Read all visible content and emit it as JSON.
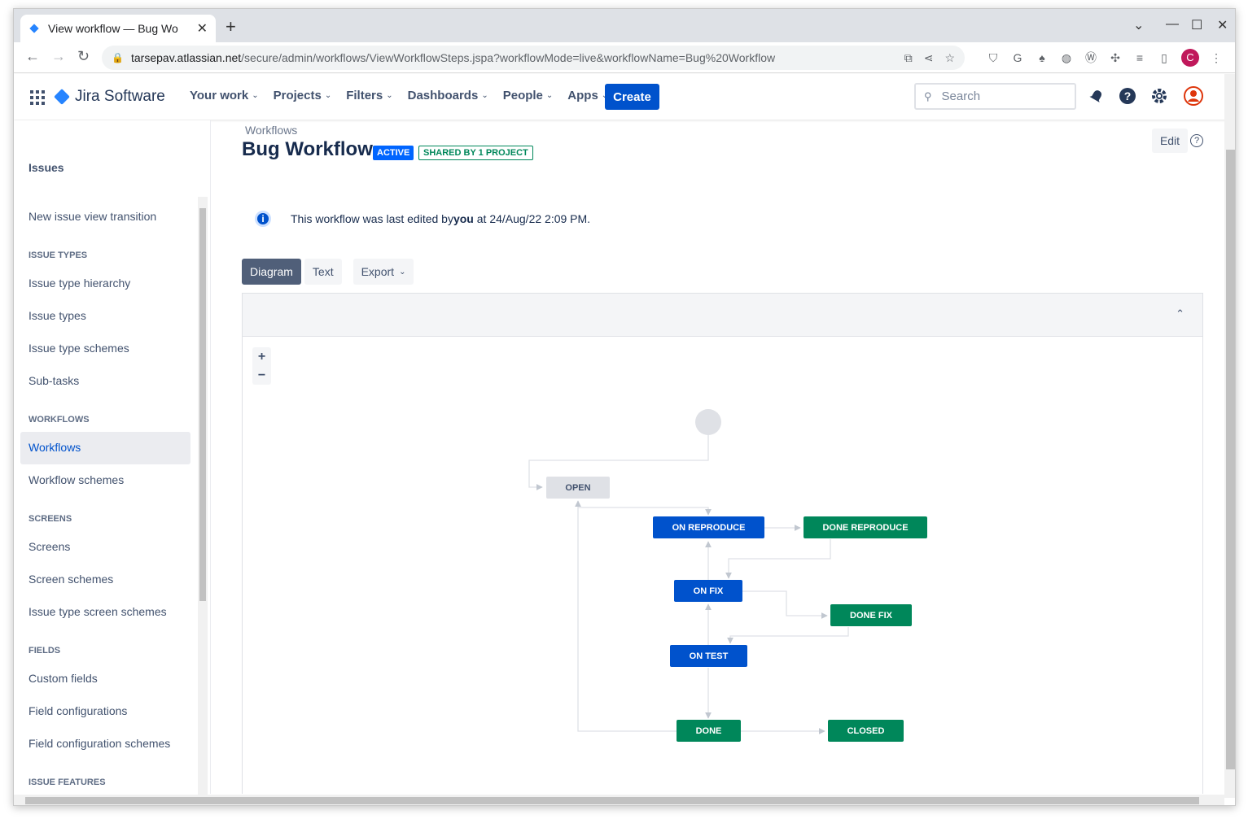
{
  "browser": {
    "tab_title": "View workflow — Bug Wo",
    "url_host": "tarsepav.atlassian.net",
    "url_path": "/secure/admin/workflows/ViewWorkflowSteps.jspa?workflowMode=live&workflowName=Bug%20Workflow",
    "profile_initial": "C"
  },
  "header": {
    "product": "Jira Software",
    "nav": [
      "Your work",
      "Projects",
      "Filters",
      "Dashboards",
      "People",
      "Apps"
    ],
    "create_label": "Create",
    "search_placeholder": "Search"
  },
  "sidebar": {
    "section_title": "Issues",
    "top_link": "New issue view transition",
    "issue_types_cat": "ISSUE TYPES",
    "issue_types": [
      "Issue type hierarchy",
      "Issue types",
      "Issue type schemes",
      "Sub-tasks"
    ],
    "workflows_cat": "WORKFLOWS",
    "workflows": [
      "Workflows",
      "Workflow schemes"
    ],
    "screens_cat": "SCREENS",
    "screens": [
      "Screens",
      "Screen schemes",
      "Issue type screen schemes"
    ],
    "fields_cat": "FIELDS",
    "fields": [
      "Custom fields",
      "Field configurations",
      "Field configuration schemes"
    ],
    "issue_features_cat": "ISSUE FEATURES"
  },
  "page": {
    "breadcrumb": "Workflows",
    "title": "Bug Workflow",
    "status_lozenge": "ACTIVE",
    "shared_lozenge": "SHARED BY 1 PROJECT",
    "edit_label": "Edit",
    "info_prefix": "This workflow was last edited by ",
    "info_user": "you",
    "info_suffix": " at 24/Aug/22 2:09 PM.",
    "tabs": [
      "Diagram",
      "Text"
    ],
    "export_label": "Export"
  },
  "diagram": {
    "statuses": [
      "OPEN",
      "ON REPRODUCE",
      "DONE REPRODUCE",
      "ON FIX",
      "DONE FIX",
      "ON TEST",
      "DONE",
      "CLOSED"
    ],
    "colors": {
      "todo": "#dfe1e6",
      "in_progress": "#0052cc",
      "done": "#00875a"
    }
  }
}
